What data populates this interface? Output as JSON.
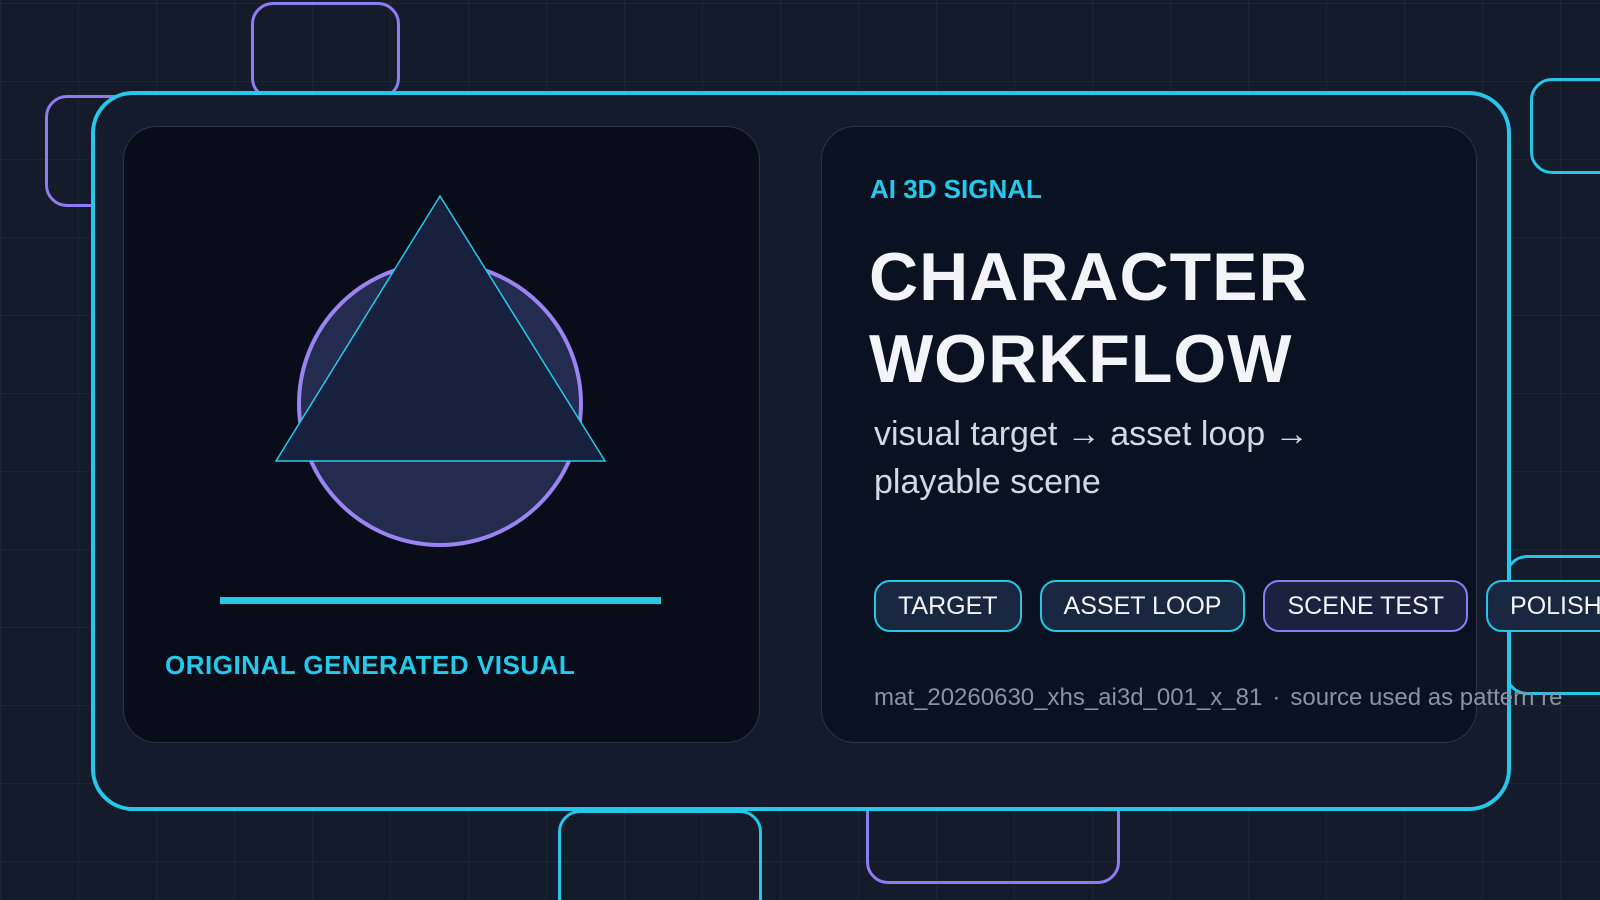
{
  "colors": {
    "background": "#141b2b",
    "accent_cyan": "#26c7e8",
    "accent_purple": "#8f7cf0",
    "panel": "#080d19",
    "text_primary": "#f2f4f8",
    "text_muted": "#8a92a3"
  },
  "visual": {
    "caption": "ORIGINAL GENERATED VISUAL",
    "shapes": [
      "circle",
      "triangle",
      "underline-bar"
    ]
  },
  "info": {
    "eyebrow": "AI 3D SIGNAL",
    "title_line1": "CHARACTER",
    "title_line2": "WORKFLOW",
    "subtitle": "visual target → asset loop → playable scene"
  },
  "chips": [
    {
      "label": "TARGET",
      "style": "cyan"
    },
    {
      "label": "ASSET LOOP",
      "style": "cyan"
    },
    {
      "label": "SCENE TEST",
      "style": "purple"
    },
    {
      "label": "POLISH",
      "style": "cyan"
    }
  ],
  "meta": {
    "id": "mat_20260630_xhs_ai3d_001_x_81",
    "separator": "·",
    "note": "source used as pattern re"
  }
}
